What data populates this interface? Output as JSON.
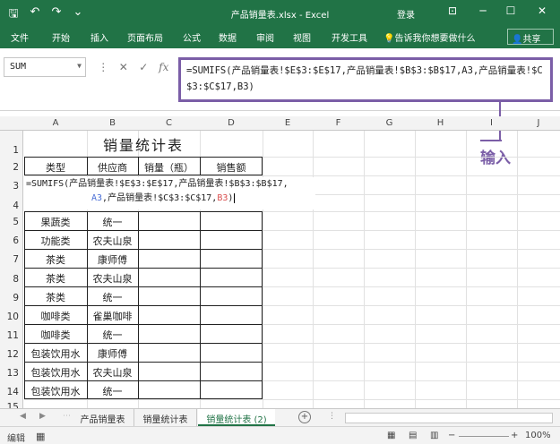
{
  "window": {
    "title": "产品销量表.xlsx - Excel",
    "login": "登录",
    "qat": {
      "save": "🖫",
      "undo": "↶",
      "redo": "↷",
      "more": "⌄"
    },
    "win_ctrls": {
      "ribbon": "⊡",
      "min": "─",
      "max": "☐",
      "close": "✕"
    }
  },
  "menu": {
    "items": [
      "文件",
      "开始",
      "插入",
      "页面布局",
      "公式",
      "数据",
      "审阅",
      "视图",
      "开发工具"
    ],
    "tell_me": "告诉我你想要做什么",
    "share": "共享"
  },
  "formula_bar": {
    "name_box": "SUM",
    "formula": "=SUMIFS(产品销量表!$E$3:$E$17,产品销量表!$B$3:$B$17,A3,产品销量表!$C$3:$C$17,B3)"
  },
  "callout": "输入",
  "columns": [
    "A",
    "B",
    "C",
    "D",
    "E",
    "F",
    "G",
    "H",
    "I",
    "J"
  ],
  "rows": [
    "1",
    "2",
    "3",
    "4",
    "5",
    "6",
    "7",
    "8",
    "9",
    "10",
    "11",
    "12",
    "13",
    "14",
    "15"
  ],
  "sheet": {
    "title": "销量统计表",
    "headers": [
      "类型",
      "供应商",
      "销量（瓶）",
      "销售额"
    ],
    "edit_line1": "=SUMIFS(产品销量表!$E$3:$E$17,产品销量表!$B$3:$B$17,",
    "edit_line2_a": "A3",
    "edit_line2_mid": ",产品销量表!$C$3:$C$17,",
    "edit_line2_b": "B3",
    "edit_line2_end": ")",
    "data": [
      [
        "果蔬类",
        "统一"
      ],
      [
        "功能类",
        "农夫山泉"
      ],
      [
        "茶类",
        "康师傅"
      ],
      [
        "茶类",
        "农夫山泉"
      ],
      [
        "茶类",
        "统一"
      ],
      [
        "咖啡类",
        "雀巢咖啡"
      ],
      [
        "咖啡类",
        "统一"
      ],
      [
        "包装饮用水",
        "康师傅"
      ],
      [
        "包装饮用水",
        "农夫山泉"
      ],
      [
        "包装饮用水",
        "统一"
      ]
    ]
  },
  "tabs": {
    "sheets": [
      "产品销量表",
      "销量统计表",
      "销量统计表 (2)"
    ],
    "active_index": 2
  },
  "status": {
    "mode": "编辑",
    "zoom": "100%"
  },
  "colors": {
    "excel_green": "#217346",
    "callout_purple": "#7b5ea7"
  }
}
